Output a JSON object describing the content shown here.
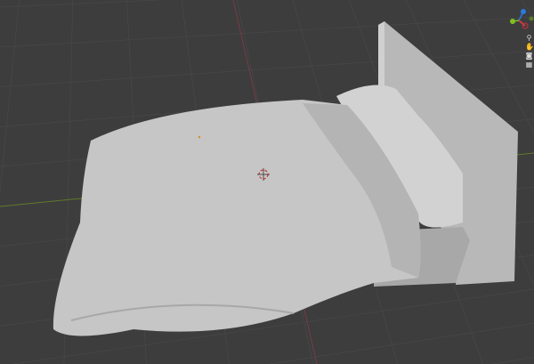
{
  "viewport": {
    "background_color": "#3d3d3d",
    "grid_color": "#4a4a4a",
    "x_axis_color": "#8a3a44",
    "y_axis_color": "#6b8a2a",
    "model_color": "#c4c4c4"
  },
  "gizmo": {
    "x_color": "#e0404a",
    "y_color": "#80c020",
    "z_color": "#2a7ae0"
  },
  "nav_icons": [
    "zoom-icon",
    "pan-hand-icon",
    "camera-icon",
    "grid-view-icon"
  ]
}
